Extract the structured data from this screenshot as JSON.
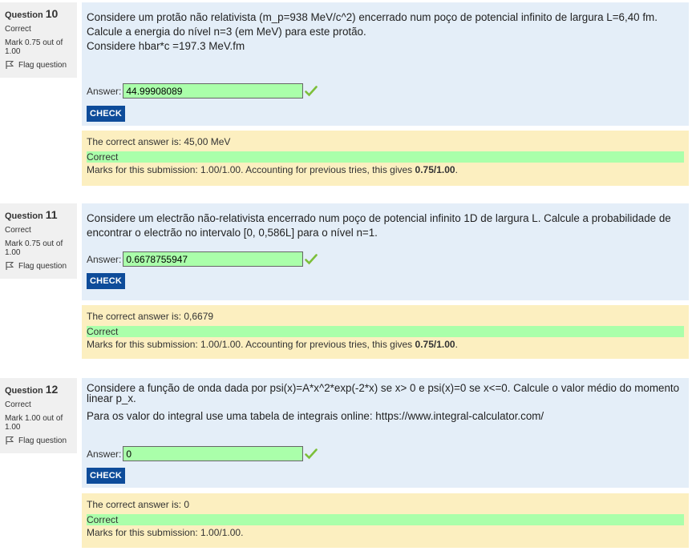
{
  "questions": [
    {
      "label": "Question",
      "number": "10",
      "state": "Correct",
      "grade": "Mark 0.75 out of 1.00",
      "flag": "Flag question",
      "text": [
        "Considere um protão não relativista (m_p=938 MeV/c^2) encerrado num poço de potencial infinito de largura L=6,40 fm. Calcule a energia do nível n=3 (em MeV) para este protão.",
        "Considere hbar*c =197.3 MeV.fm"
      ],
      "answer_label": "Answer:",
      "answer_value": "44.99908089",
      "check_label": "CHECK",
      "right_answer": "The correct answer is: 45,00 MeV",
      "feedback": "Correct",
      "marks_text": "Marks for this submission: 1.00/1.00. Accounting for previous tries, this gives ",
      "marks_bold": "0.75/1.00",
      "marks_end": "."
    },
    {
      "label": "Question",
      "number": "11",
      "state": "Correct",
      "grade": "Mark 0.75 out of 1.00",
      "flag": "Flag question",
      "text": [
        "Considere um electrão não-relativista encerrado num poço de potencial infinito 1D de largura L. Calcule a probabilidade de encontrar o electrão no intervalo [0, 0,586L] para o nível n=1."
      ],
      "answer_label": "Answer:",
      "answer_value": "0.6678755947",
      "check_label": "CHECK",
      "right_answer": "The correct answer is: 0,6679",
      "feedback": "Correct",
      "marks_text": "Marks for this submission: 1.00/1.00. Accounting for previous tries, this gives ",
      "marks_bold": "0.75/1.00",
      "marks_end": "."
    },
    {
      "label": "Question",
      "number": "12",
      "state": "Correct",
      "grade": "Mark 1.00 out of 1.00",
      "flag": "Flag question",
      "text": [
        "Considere a função de onda dada por psi(x)=A*x^2*exp(-2*x) se x> 0 e psi(x)=0 se x<=0. Calcule o valor médio do momento linear p_x.",
        "Para os valor do integral use uma tabela de integrais online: https://www.integral-calculator.com/"
      ],
      "answer_label": "Answer:",
      "answer_value": "0",
      "check_label": "CHECK",
      "right_answer": "The correct answer is: 0",
      "feedback": "Correct",
      "marks_text": "Marks for this submission: 1.00/1.00.",
      "marks_bold": "",
      "marks_end": ""
    }
  ],
  "colors": {
    "info_bg": "#f0f0f0",
    "formulation_bg": "#e4eef8",
    "outcome_bg": "#fcefc0",
    "correct_green": "#aaffaa",
    "check_button": "#0e4c9a",
    "tick": "#7cbf3a"
  },
  "icons": {
    "flag": "flag-icon",
    "tick": "correct-tick-icon"
  }
}
